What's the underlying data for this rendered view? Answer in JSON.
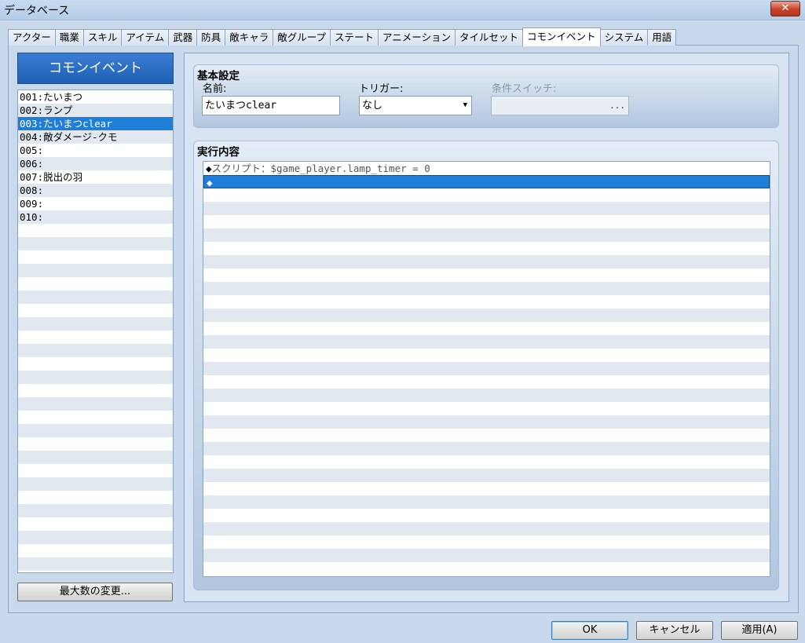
{
  "window": {
    "title": "データベース",
    "close_glyph": "✕"
  },
  "tabs": [
    {
      "label": "アクター",
      "active": false
    },
    {
      "label": "職業",
      "active": false
    },
    {
      "label": "スキル",
      "active": false
    },
    {
      "label": "アイテム",
      "active": false
    },
    {
      "label": "武器",
      "active": false
    },
    {
      "label": "防具",
      "active": false
    },
    {
      "label": "敵キャラ",
      "active": false
    },
    {
      "label": "敵グループ",
      "active": false
    },
    {
      "label": "ステート",
      "active": false
    },
    {
      "label": "アニメーション",
      "active": false
    },
    {
      "label": "タイルセット",
      "active": false
    },
    {
      "label": "コモンイベント",
      "active": true
    },
    {
      "label": "システム",
      "active": false
    },
    {
      "label": "用語",
      "active": false
    }
  ],
  "left_panel": {
    "header": "コモンイベント",
    "items": [
      {
        "label": "001:たいまつ",
        "selected": false
      },
      {
        "label": "002:ランプ",
        "selected": false
      },
      {
        "label": "003:たいまつclear",
        "selected": true
      },
      {
        "label": "004:敵ダメージ-クモ",
        "selected": false
      },
      {
        "label": "005:",
        "selected": false
      },
      {
        "label": "006:",
        "selected": false
      },
      {
        "label": "007:脱出の羽",
        "selected": false
      },
      {
        "label": "008:",
        "selected": false
      },
      {
        "label": "009:",
        "selected": false
      },
      {
        "label": "010:",
        "selected": false
      }
    ],
    "max_button": "最大数の変更..."
  },
  "basic_settings": {
    "title": "基本設定",
    "name_label": "名前:",
    "name_value": "たいまつclear",
    "trigger_label": "トリガー:",
    "trigger_value": "なし",
    "switch_label": "条件スイッチ:",
    "switch_value": "",
    "switch_button": "..."
  },
  "contents": {
    "title": "実行内容",
    "commands": [
      {
        "marker": "◆",
        "text": "スクリプト：$game_player.lamp_timer = 0",
        "selected": false
      },
      {
        "marker": "◆",
        "text": "",
        "selected": true
      }
    ]
  },
  "buttons": {
    "ok": "OK",
    "cancel": "キャンセル",
    "apply": "適用(A)"
  }
}
